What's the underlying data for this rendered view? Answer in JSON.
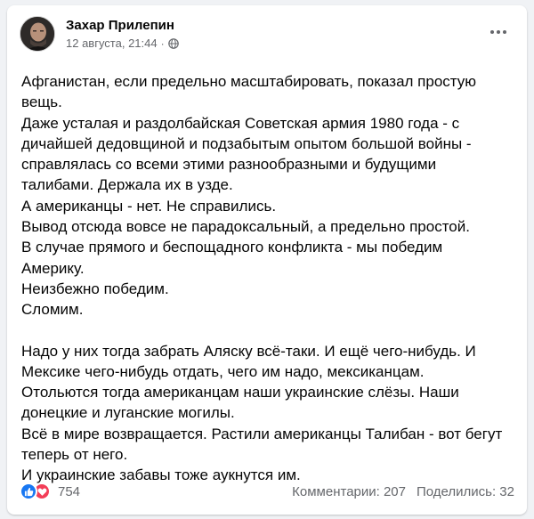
{
  "post": {
    "author": "Захар Прилепин",
    "date": "12 августа, 21:44",
    "separator": "·",
    "paragraphs": [
      {
        "lines": [
          "Афганистан, если предельно масштабировать, показал простую",
          "вещь.",
          "Даже усталая и раздолбайская Советская армия 1980 года - с",
          "дичайшей дедовщиной и подзабытым опытом большой войны -",
          "справлялась со всеми этими разнообразными и будущими",
          "талибами. Держала их в узде.",
          "А американцы - нет. Не справились.",
          "Вывод отсюда вовсе не парадоксальный, а предельно простой.",
          "В случае прямого и беспощадного конфликта - мы победим",
          "Америку.",
          "Неизбежно победим.",
          "Сломим."
        ]
      },
      {
        "lines": [
          "Надо у них тогда забрать Аляску всё-таки. И ещё чего-нибудь. И",
          "Мексике чего-нибудь отдать, чего им надо, мексиканцам.",
          "Отольются тогда американцам наши украинские слёзы. Наши",
          "донецкие и луганские могилы.",
          "Всё в мире возвращается. Растили американцы Талибан - вот бегут",
          "теперь от него.",
          "И украинские забавы тоже аукнутся им."
        ]
      }
    ]
  },
  "footer": {
    "reaction_count": "754",
    "comments": "Комментарии: 207",
    "shares": "Поделились: 32"
  },
  "icons": {
    "privacy": "globe-icon",
    "more": "more-options-icon",
    "like": "like-icon",
    "love": "love-icon"
  },
  "colors": {
    "like": "#1877f2",
    "love": "#f33e58",
    "secondary_text": "#65676b"
  }
}
